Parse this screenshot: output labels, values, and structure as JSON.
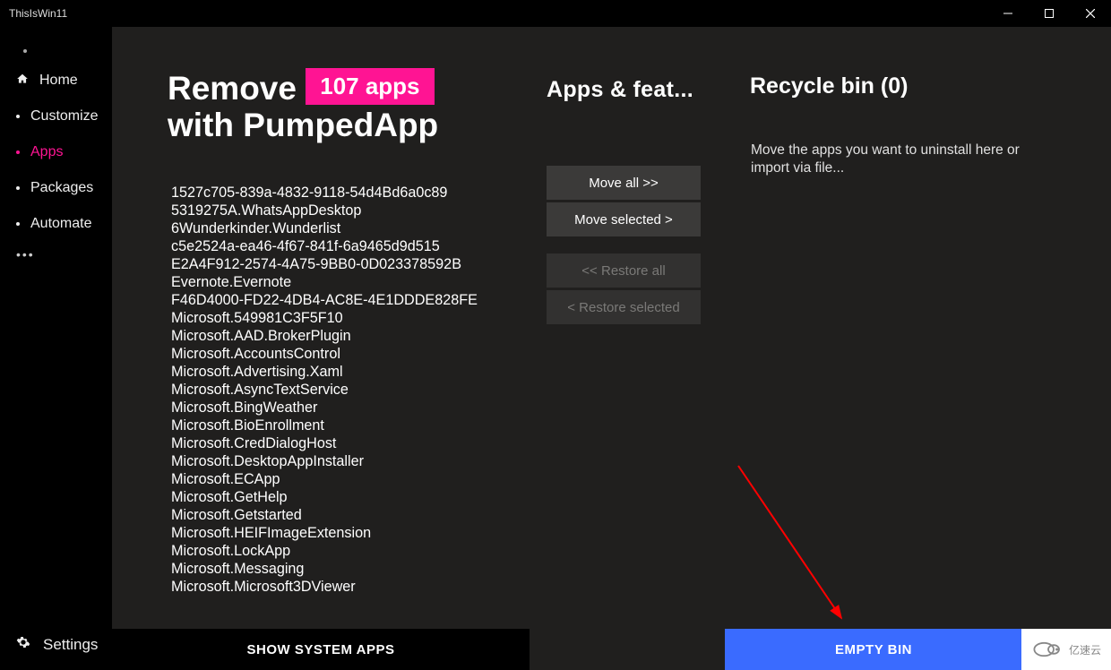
{
  "window": {
    "title": "ThisIsWin11"
  },
  "nav": {
    "items": [
      {
        "label": "Home"
      },
      {
        "label": "Customize"
      },
      {
        "label": "Apps"
      },
      {
        "label": "Packages"
      },
      {
        "label": "Automate"
      }
    ],
    "settings": "Settings"
  },
  "heading": {
    "line1_pre": "Remove ",
    "badge": "107 apps",
    "line2": "with PumpedApp"
  },
  "apps": [
    "1527c705-839a-4832-9118-54d4Bd6a0c89",
    "5319275A.WhatsAppDesktop",
    "6Wunderkinder.Wunderlist",
    "c5e2524a-ea46-4f67-841f-6a9465d9d515",
    "E2A4F912-2574-4A75-9BB0-0D023378592B",
    "Evernote.Evernote",
    "F46D4000-FD22-4DB4-AC8E-4E1DDDE828FE",
    "Microsoft.549981C3F5F10",
    "Microsoft.AAD.BrokerPlugin",
    "Microsoft.AccountsControl",
    "Microsoft.Advertising.Xaml",
    "Microsoft.AsyncTextService",
    "Microsoft.BingWeather",
    "Microsoft.BioEnrollment",
    "Microsoft.CredDialogHost",
    "Microsoft.DesktopAppInstaller",
    "Microsoft.ECApp",
    "Microsoft.GetHelp",
    "Microsoft.Getstarted",
    "Microsoft.HEIFImageExtension",
    "Microsoft.LockApp",
    "Microsoft.Messaging",
    "Microsoft.Microsoft3DViewer"
  ],
  "show_system": "SHOW SYSTEM APPS",
  "middle": {
    "title": "Apps & feat...",
    "move_all": "Move all >>",
    "move_selected": "Move selected >",
    "restore_all": "<< Restore all",
    "restore_selected": "< Restore selected"
  },
  "bin": {
    "title": "Recycle bin (0)",
    "hint": "Move the apps you want to uninstall here or import via file..."
  },
  "empty_bin": "EMPTY BIN",
  "watermark": "亿速云"
}
